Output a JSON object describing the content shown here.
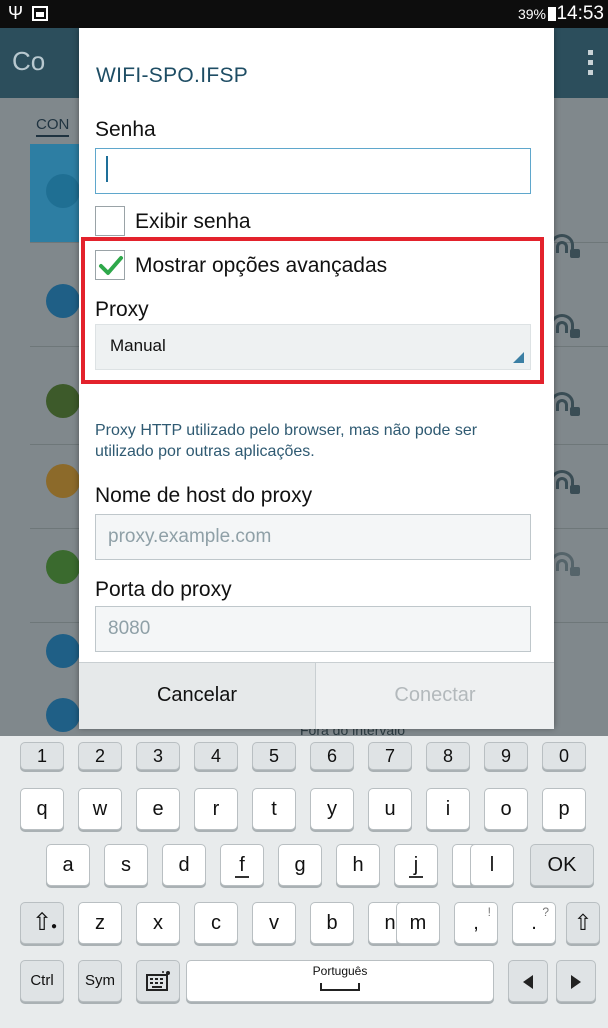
{
  "status_bar": {
    "battery": "39%",
    "time": "14:53"
  },
  "background": {
    "title": "Co",
    "tab": "CON",
    "list_text": "Fora do intervalo"
  },
  "dialog": {
    "title": "WIFI-SPO.IFSP",
    "password_label": "Senha",
    "password_value": "",
    "show_password_label": "Exibir senha",
    "show_password_checked": false,
    "advanced_label": "Mostrar opções avançadas",
    "advanced_checked": true,
    "proxy_label": "Proxy",
    "proxy_value": "Manual",
    "proxy_help": "Proxy HTTP utilizado pelo browser, mas não pode ser utilizado por outras aplicações.",
    "host_label": "Nome de host do proxy",
    "host_placeholder": "proxy.example.com",
    "port_label": "Porta do proxy",
    "port_placeholder": "8080",
    "cancel_label": "Cancelar",
    "connect_label": "Conectar",
    "connect_enabled": false
  },
  "keyboard": {
    "numbers": [
      "1",
      "2",
      "3",
      "4",
      "5",
      "6",
      "7",
      "8",
      "9",
      "0"
    ],
    "row1": [
      "q",
      "w",
      "e",
      "r",
      "t",
      "y",
      "u",
      "i",
      "o",
      "p"
    ],
    "row2": [
      "a",
      "s",
      "d",
      "f",
      "g",
      "h",
      "j",
      "k",
      "l"
    ],
    "row2_ok": "OK",
    "row3": [
      "z",
      "x",
      "c",
      "v",
      "b",
      "n",
      "m"
    ],
    "row3_comma": ",",
    "row3_comma_sub": "!",
    "row3_period": ".",
    "row3_period_sub": "?",
    "ctrl": "Ctrl",
    "sym": "Sym",
    "language": "Português"
  },
  "colors": {
    "highlight": "#e3222c",
    "accent": "#1e4d64",
    "check": "#2ea84a"
  }
}
